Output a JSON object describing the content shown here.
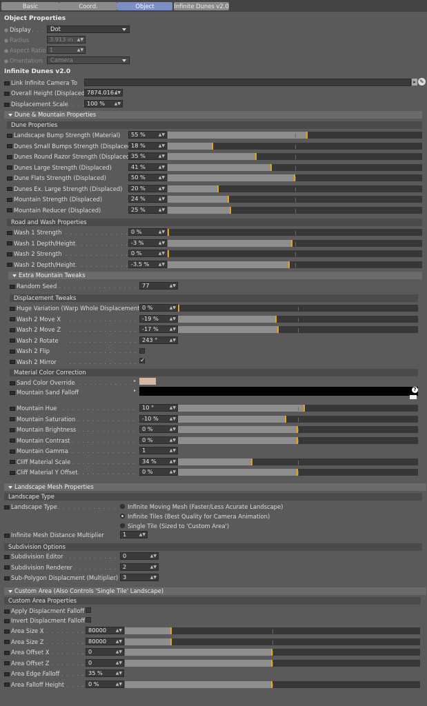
{
  "tabs": [
    "Basic",
    "Coord.",
    "Object",
    "Infinite Dunes v2.0"
  ],
  "active_tab_index": 2,
  "object_properties": {
    "title": "Object Properties",
    "display_label": "Display",
    "display_value": "Dot",
    "radius_label": "Radius",
    "radius_value": "3.913 in",
    "aspect_label": "Aspect Ratio",
    "aspect_value": "1",
    "orientation_label": "Orientation",
    "orientation_value": "Camera"
  },
  "infinite_dunes": {
    "title": "Infinite Dunes v2.0",
    "link_camera_label": "Link Infinite Camera To",
    "link_camera_value": "",
    "overall_height_label": "Overall Height (Displaced)",
    "overall_height_value": "7874.016 i",
    "displacement_scale_label": "Displacement Scale",
    "displacement_scale_value": "100 %"
  },
  "dune_mountain": {
    "title": "Dune & Mountain Properties",
    "dune_group": "Dune Properties",
    "dune_rows": [
      {
        "label": "Landscape Bump Strength (Material)",
        "value": "55 %",
        "level": 0.55
      },
      {
        "label": "Dunes Small Bumps Strength (Displaced)",
        "value": "18 %",
        "level": 0.18
      },
      {
        "label": "Dunes Round Razor Strength (Displaced)",
        "value": "35 %",
        "level": 0.35
      },
      {
        "label": "Dunes Large Strength (Displaced)",
        "value": "41 %",
        "level": 0.41
      },
      {
        "label": "Dune Flats Strength (Displaced)",
        "value": "50 %",
        "level": 0.5
      },
      {
        "label": "Dunes Ex. Large Strength (Displaced)",
        "value": "20 %",
        "level": 0.2
      },
      {
        "label": "Mountain Strength (Displaced)",
        "value": "24 %",
        "level": 0.24
      },
      {
        "label": "Mountain Reducer (Displaced)",
        "value": "25 %",
        "level": 0.25
      }
    ],
    "road_group": "Road and Wash Properties",
    "road_rows": [
      {
        "label": "Wash 1 Strength",
        "value": "0 %",
        "level": 0.0
      },
      {
        "label": "Wash 1 Depth/Height",
        "value": "-3 %",
        "level": 0.49
      },
      {
        "label": "Wash 2 Strength",
        "value": "0 %",
        "level": 0.0
      },
      {
        "label": "Wash 2 Depth/Height",
        "value": "-3.5 %",
        "level": 0.48
      }
    ]
  },
  "extra_mountain": {
    "title": "Extra Mountain Tweaks",
    "random_seed_label": "Random Seed",
    "random_seed_value": "77",
    "displacement_group": "Displacement Tweaks",
    "disp_rows": [
      {
        "label": "Huge Variation (Warp Whole Displacement)",
        "value": "0 %",
        "level": 0.0
      },
      {
        "label": "Wash 2 Move X",
        "value": "-19 %",
        "level": 0.41
      },
      {
        "label": "Wash 2 Move Z",
        "value": "-17 %",
        "level": 0.42
      },
      {
        "label": "Wash 2 Rotate",
        "value": "243 °"
      },
      {
        "label": "Wash 2 Flip"
      },
      {
        "label": "Wash 2 Mirror"
      }
    ],
    "wash2_flip_checked": false,
    "wash2_mirror_checked": true,
    "material_group": "Material Color Correction",
    "sand_color_label": "Sand Color Override",
    "sand_color": "#d6b9a4",
    "sand_falloff_label": "Mountain Sand Falloff",
    "mat_rows": [
      {
        "label": "Mountain Hue",
        "value": "10 °",
        "level": 0.53
      },
      {
        "label": "Mountain Saturation",
        "value": "-10 %",
        "level": 0.45
      },
      {
        "label": "Mountain Brightness",
        "value": "0 %",
        "level": 0.5
      },
      {
        "label": "Mountain Contrast",
        "value": "0 %",
        "level": 0.5
      },
      {
        "label": "Mountain Gamma",
        "value": "1"
      },
      {
        "label": "Cliff Material Scale",
        "value": "34 %",
        "level": 0.31
      },
      {
        "label": "Cliff Material Y Offset",
        "value": "0 %",
        "level": 0.5
      }
    ]
  },
  "landscape_mesh": {
    "title": "Landscape Mesh Properties",
    "type_group": "Landscape Type",
    "type_label": "Landscape Type",
    "options": [
      "Infinite Moving Mesh (Faster/Less Acurate Landscape)",
      "Infinite Tiles (Best Quality for Camera Animation)",
      "Single Tile (Sized to 'Custom Area')"
    ],
    "selected_option": 1,
    "distance_label": "Infinite Mesh Distance Multiplier",
    "distance_value": "1",
    "subdiv_group": "Subdivision Options",
    "subdiv_rows": [
      {
        "label": "Subdivision Editor",
        "value": "0"
      },
      {
        "label": "Subdivision Renderer",
        "value": "2"
      },
      {
        "label": "Sub-Polygon Displacment (Multiplier)",
        "value": "3"
      }
    ]
  },
  "custom_area": {
    "title": "Custom Area (Also Controls 'Single Tile' Landscape)",
    "group": "Custom Area Properties",
    "apply_falloff_label": "Apply Displacment Falloff",
    "invert_falloff_label": "Invert Displacment Falloff",
    "rows": [
      {
        "label": "Area Size X",
        "value": "80000",
        "level": 0.16
      },
      {
        "label": "Area Size Z",
        "value": "80000",
        "level": 0.16
      },
      {
        "label": "Area Offset X",
        "value": "0",
        "level": 0.5
      },
      {
        "label": "Area Offset Z",
        "value": "0",
        "level": 0.5
      },
      {
        "label": "Area Edge Falloff",
        "value": "35 %"
      },
      {
        "label": "Area Falloff Height",
        "value": "0 %",
        "level": 0.5
      }
    ]
  },
  "colors": {
    "panel": "#5a5a5a",
    "accent": "#e8a31a",
    "active_tab": "#7d8ec4"
  }
}
